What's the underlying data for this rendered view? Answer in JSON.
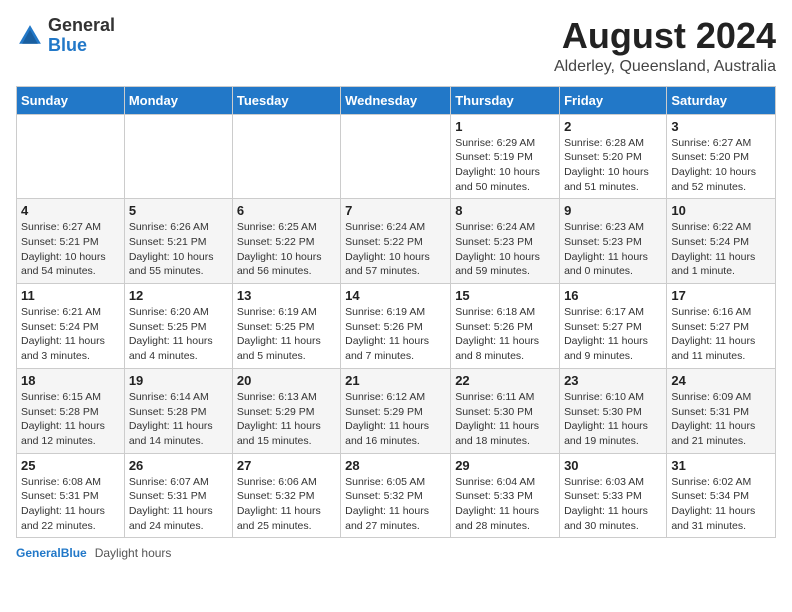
{
  "header": {
    "logo_general": "General",
    "logo_blue": "Blue",
    "title": "August 2024",
    "subtitle": "Alderley, Queensland, Australia"
  },
  "days_of_week": [
    "Sunday",
    "Monday",
    "Tuesday",
    "Wednesday",
    "Thursday",
    "Friday",
    "Saturday"
  ],
  "weeks": [
    [
      {
        "day": "",
        "detail": ""
      },
      {
        "day": "",
        "detail": ""
      },
      {
        "day": "",
        "detail": ""
      },
      {
        "day": "",
        "detail": ""
      },
      {
        "day": "1",
        "detail": "Sunrise: 6:29 AM\nSunset: 5:19 PM\nDaylight: 10 hours and 50 minutes."
      },
      {
        "day": "2",
        "detail": "Sunrise: 6:28 AM\nSunset: 5:20 PM\nDaylight: 10 hours and 51 minutes."
      },
      {
        "day": "3",
        "detail": "Sunrise: 6:27 AM\nSunset: 5:20 PM\nDaylight: 10 hours and 52 minutes."
      }
    ],
    [
      {
        "day": "4",
        "detail": "Sunrise: 6:27 AM\nSunset: 5:21 PM\nDaylight: 10 hours and 54 minutes."
      },
      {
        "day": "5",
        "detail": "Sunrise: 6:26 AM\nSunset: 5:21 PM\nDaylight: 10 hours and 55 minutes."
      },
      {
        "day": "6",
        "detail": "Sunrise: 6:25 AM\nSunset: 5:22 PM\nDaylight: 10 hours and 56 minutes."
      },
      {
        "day": "7",
        "detail": "Sunrise: 6:24 AM\nSunset: 5:22 PM\nDaylight: 10 hours and 57 minutes."
      },
      {
        "day": "8",
        "detail": "Sunrise: 6:24 AM\nSunset: 5:23 PM\nDaylight: 10 hours and 59 minutes."
      },
      {
        "day": "9",
        "detail": "Sunrise: 6:23 AM\nSunset: 5:23 PM\nDaylight: 11 hours and 0 minutes."
      },
      {
        "day": "10",
        "detail": "Sunrise: 6:22 AM\nSunset: 5:24 PM\nDaylight: 11 hours and 1 minute."
      }
    ],
    [
      {
        "day": "11",
        "detail": "Sunrise: 6:21 AM\nSunset: 5:24 PM\nDaylight: 11 hours and 3 minutes."
      },
      {
        "day": "12",
        "detail": "Sunrise: 6:20 AM\nSunset: 5:25 PM\nDaylight: 11 hours and 4 minutes."
      },
      {
        "day": "13",
        "detail": "Sunrise: 6:19 AM\nSunset: 5:25 PM\nDaylight: 11 hours and 5 minutes."
      },
      {
        "day": "14",
        "detail": "Sunrise: 6:19 AM\nSunset: 5:26 PM\nDaylight: 11 hours and 7 minutes."
      },
      {
        "day": "15",
        "detail": "Sunrise: 6:18 AM\nSunset: 5:26 PM\nDaylight: 11 hours and 8 minutes."
      },
      {
        "day": "16",
        "detail": "Sunrise: 6:17 AM\nSunset: 5:27 PM\nDaylight: 11 hours and 9 minutes."
      },
      {
        "day": "17",
        "detail": "Sunrise: 6:16 AM\nSunset: 5:27 PM\nDaylight: 11 hours and 11 minutes."
      }
    ],
    [
      {
        "day": "18",
        "detail": "Sunrise: 6:15 AM\nSunset: 5:28 PM\nDaylight: 11 hours and 12 minutes."
      },
      {
        "day": "19",
        "detail": "Sunrise: 6:14 AM\nSunset: 5:28 PM\nDaylight: 11 hours and 14 minutes."
      },
      {
        "day": "20",
        "detail": "Sunrise: 6:13 AM\nSunset: 5:29 PM\nDaylight: 11 hours and 15 minutes."
      },
      {
        "day": "21",
        "detail": "Sunrise: 6:12 AM\nSunset: 5:29 PM\nDaylight: 11 hours and 16 minutes."
      },
      {
        "day": "22",
        "detail": "Sunrise: 6:11 AM\nSunset: 5:30 PM\nDaylight: 11 hours and 18 minutes."
      },
      {
        "day": "23",
        "detail": "Sunrise: 6:10 AM\nSunset: 5:30 PM\nDaylight: 11 hours and 19 minutes."
      },
      {
        "day": "24",
        "detail": "Sunrise: 6:09 AM\nSunset: 5:31 PM\nDaylight: 11 hours and 21 minutes."
      }
    ],
    [
      {
        "day": "25",
        "detail": "Sunrise: 6:08 AM\nSunset: 5:31 PM\nDaylight: 11 hours and 22 minutes."
      },
      {
        "day": "26",
        "detail": "Sunrise: 6:07 AM\nSunset: 5:31 PM\nDaylight: 11 hours and 24 minutes."
      },
      {
        "day": "27",
        "detail": "Sunrise: 6:06 AM\nSunset: 5:32 PM\nDaylight: 11 hours and 25 minutes."
      },
      {
        "day": "28",
        "detail": "Sunrise: 6:05 AM\nSunset: 5:32 PM\nDaylight: 11 hours and 27 minutes."
      },
      {
        "day": "29",
        "detail": "Sunrise: 6:04 AM\nSunset: 5:33 PM\nDaylight: 11 hours and 28 minutes."
      },
      {
        "day": "30",
        "detail": "Sunrise: 6:03 AM\nSunset: 5:33 PM\nDaylight: 11 hours and 30 minutes."
      },
      {
        "day": "31",
        "detail": "Sunrise: 6:02 AM\nSunset: 5:34 PM\nDaylight: 11 hours and 31 minutes."
      }
    ]
  ],
  "footer": {
    "logo": "GeneralBlue",
    "daylight_label": "Daylight hours"
  }
}
